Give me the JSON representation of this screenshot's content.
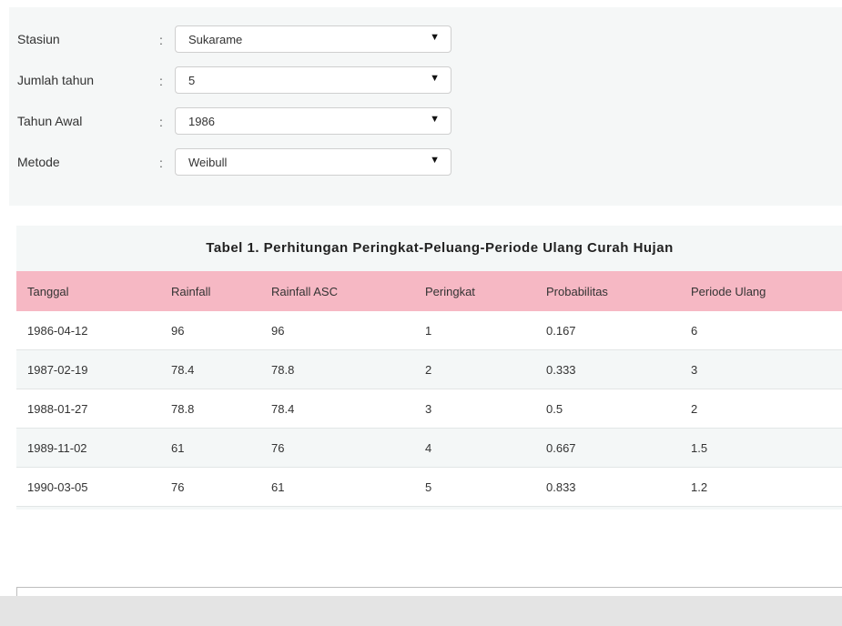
{
  "form": {
    "fields": [
      {
        "label": "Stasiun",
        "value": "Sukarame"
      },
      {
        "label": "Jumlah tahun",
        "value": "5"
      },
      {
        "label": "Tahun Awal",
        "value": "1986"
      },
      {
        "label": "Metode",
        "value": "Weibull"
      }
    ],
    "colon": ":",
    "caret": "▼"
  },
  "table": {
    "title": "Tabel 1. Perhitungan Peringkat-Peluang-Periode Ulang Curah Hujan",
    "headers": [
      "Tanggal",
      "Rainfall",
      "Rainfall ASC",
      "Peringkat",
      "Probabilitas",
      "Periode Ulang"
    ],
    "rows": [
      [
        "1986-04-12",
        "96",
        "96",
        "1",
        "0.167",
        "6"
      ],
      [
        "1987-02-19",
        "78.4",
        "78.8",
        "2",
        "0.333",
        "3"
      ],
      [
        "1988-01-27",
        "78.8",
        "78.4",
        "3",
        "0.5",
        "2"
      ],
      [
        "1989-11-02",
        "61",
        "76",
        "4",
        "0.667",
        "1.5"
      ],
      [
        "1990-03-05",
        "76",
        "61",
        "5",
        "0.833",
        "1.2"
      ]
    ]
  },
  "colors": {
    "header_bg": "#f6b8c4",
    "panel_bg": "#f5f7f7"
  }
}
